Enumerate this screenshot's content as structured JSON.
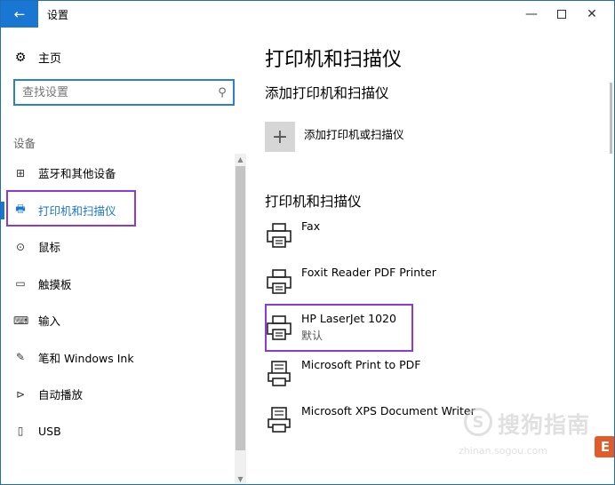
{
  "window": {
    "title": "设置",
    "back_icon": "←",
    "minimize_icon": "—",
    "close_icon": "✕"
  },
  "sidebar": {
    "home_label": "主页",
    "search_placeholder": "查找设置",
    "section_label": "设备",
    "items": [
      {
        "label": "蓝牙和其他设备",
        "icon": "bluetooth-icon",
        "glyph": "⊞",
        "active": false
      },
      {
        "label": "打印机和扫描仪",
        "icon": "printer-icon",
        "glyph": "🖶",
        "active": true
      },
      {
        "label": "鼠标",
        "icon": "mouse-icon",
        "glyph": "⊙",
        "active": false
      },
      {
        "label": "触摸板",
        "icon": "touchpad-icon",
        "glyph": "▭",
        "active": false
      },
      {
        "label": "输入",
        "icon": "keyboard-icon",
        "glyph": "⌨",
        "active": false
      },
      {
        "label": "笔和 Windows Ink",
        "icon": "pen-icon",
        "glyph": "✎",
        "active": false
      },
      {
        "label": "自动播放",
        "icon": "autoplay-icon",
        "glyph": "⊳",
        "active": false
      },
      {
        "label": "USB",
        "icon": "usb-icon",
        "glyph": "▯",
        "active": false
      }
    ]
  },
  "main": {
    "page_title": "打印机和扫描仪",
    "add_section_title": "添加打印机和扫描仪",
    "add_button_label": "添加打印机或扫描仪",
    "add_icon": "+",
    "list_section_title": "打印机和扫描仪",
    "printers": [
      {
        "name": "Fax",
        "status": "",
        "icon": "printer-icon"
      },
      {
        "name": "Foxit Reader PDF Printer",
        "status": "",
        "icon": "printer-icon"
      },
      {
        "name": "HP LaserJet 1020",
        "status": "默认",
        "icon": "printer-icon"
      },
      {
        "name": "Microsoft Print to PDF",
        "status": "",
        "icon": "document-printer-icon"
      },
      {
        "name": "Microsoft XPS Document Writer",
        "status": "",
        "icon": "document-printer-icon"
      }
    ]
  },
  "watermark": {
    "brand": "搜狗指南",
    "url": "zhinan.sogou.com",
    "logo_letter": "S",
    "badge": "E"
  }
}
